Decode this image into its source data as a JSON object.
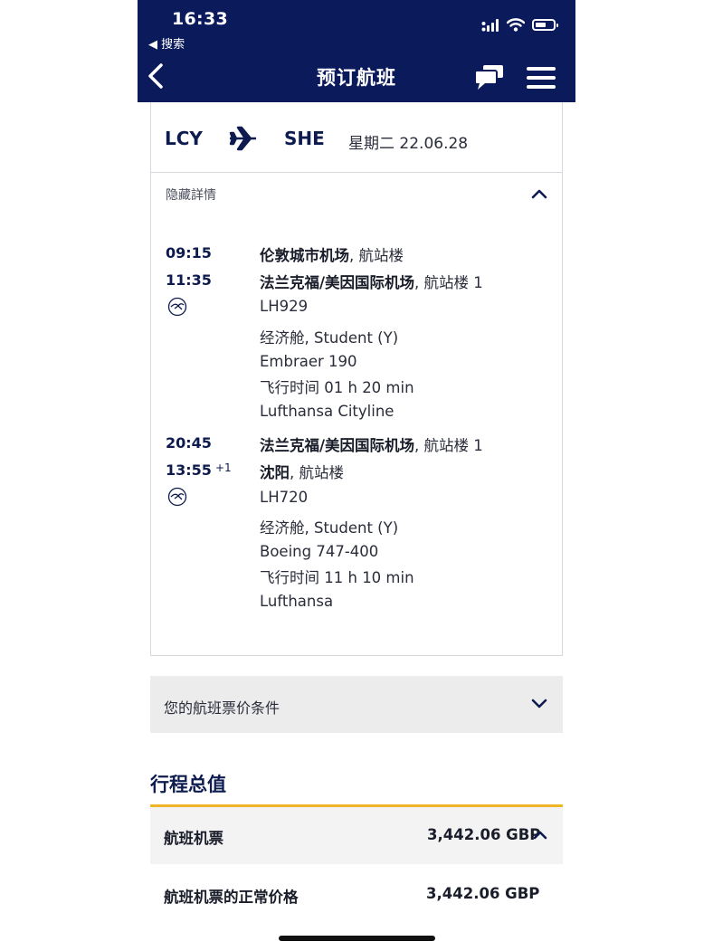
{
  "status_bar": {
    "time": "16:33",
    "back_label": "◀ 搜索"
  },
  "nav": {
    "title": "预订航班"
  },
  "route": {
    "origin": "LCY",
    "destination": "SHE",
    "date": "星期二 22.06.28"
  },
  "details_toggle": "隐藏詳情",
  "segments": [
    {
      "dep_time": "09:15",
      "dep_airport": "伦敦城市机场",
      "dep_terminal": ", 航站楼",
      "arr_time": "11:35",
      "arr_day_offset": "",
      "arr_airport": "法兰克福/美因国际机场",
      "arr_terminal": ", 航站楼 1",
      "flight_no": "LH929",
      "cabin": "经济舱, Student (Y)",
      "aircraft": "Embraer 190",
      "duration": "飞行时间 01 h 20 min",
      "operator": "Lufthansa Cityline"
    },
    {
      "dep_time": "20:45",
      "dep_airport": "法兰克福/美因国际机场",
      "dep_terminal": ", 航站楼 1",
      "arr_time": "13:55",
      "arr_day_offset": "+1",
      "arr_airport": "沈阳",
      "arr_terminal": ", 航站楼",
      "flight_no": "LH720",
      "cabin": "经济舱, Student (Y)",
      "aircraft": "Boeing 747-400",
      "duration": "飞行时间 11 h 10 min",
      "operator": "Lufthansa"
    }
  ],
  "fare_conditions": "您的航班票价条件",
  "trip_total": {
    "title": "行程总值",
    "ticket_label": "航班机票",
    "ticket_value": "3,442.06 GBP",
    "regular_label": "航班机票的正常价格",
    "regular_value": "3,442.06 GBP"
  },
  "colors": {
    "nav_bg": "#0a1a5b",
    "accent_yellow": "#f0b429",
    "text_dark": "#0d1b4f"
  }
}
